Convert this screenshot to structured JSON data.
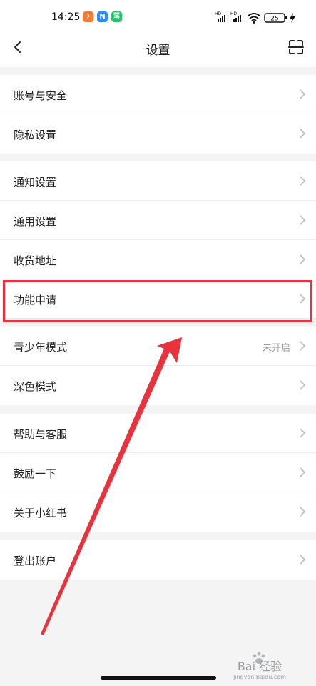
{
  "status_bar": {
    "time": "14:25",
    "app_icons": [
      {
        "name": "app-notification-icon-orange",
        "color": "#ff7a2e",
        "glyph": "✈"
      },
      {
        "name": "app-notification-icon-blue",
        "color": "#2b8cf6",
        "glyph": "N"
      },
      {
        "name": "app-notification-icon-green",
        "color": "#25c36b",
        "glyph": "驾"
      }
    ],
    "signal_labels": [
      "HD",
      "HD"
    ],
    "battery_level": "25"
  },
  "header": {
    "title": "设置"
  },
  "settings_groups": [
    {
      "items": [
        {
          "id": "account-security",
          "label": "账号与安全",
          "value": ""
        },
        {
          "id": "privacy-settings",
          "label": "隐私设置",
          "value": ""
        }
      ]
    },
    {
      "items": [
        {
          "id": "notification-settings",
          "label": "通知设置",
          "value": ""
        },
        {
          "id": "general-settings",
          "label": "通用设置",
          "value": ""
        },
        {
          "id": "shipping-address",
          "label": "收货地址",
          "value": ""
        },
        {
          "id": "feature-application",
          "label": "功能申请",
          "value": "",
          "highlighted": true
        },
        {
          "id": "youth-mode",
          "label": "青少年模式",
          "value": "未开启"
        },
        {
          "id": "dark-mode",
          "label": "深色模式",
          "value": ""
        }
      ]
    },
    {
      "items": [
        {
          "id": "help-support",
          "label": "帮助与客服",
          "value": ""
        },
        {
          "id": "encourage",
          "label": "鼓励一下",
          "value": ""
        },
        {
          "id": "about",
          "label": "关于小红书",
          "value": ""
        }
      ]
    },
    {
      "items": [
        {
          "id": "logout",
          "label": "登出账户",
          "value": ""
        }
      ]
    }
  ],
  "annotation": {
    "color": "#e8333f"
  },
  "watermark": {
    "text": "Bai 经验",
    "subtext": "jingyan.baidu.com"
  }
}
